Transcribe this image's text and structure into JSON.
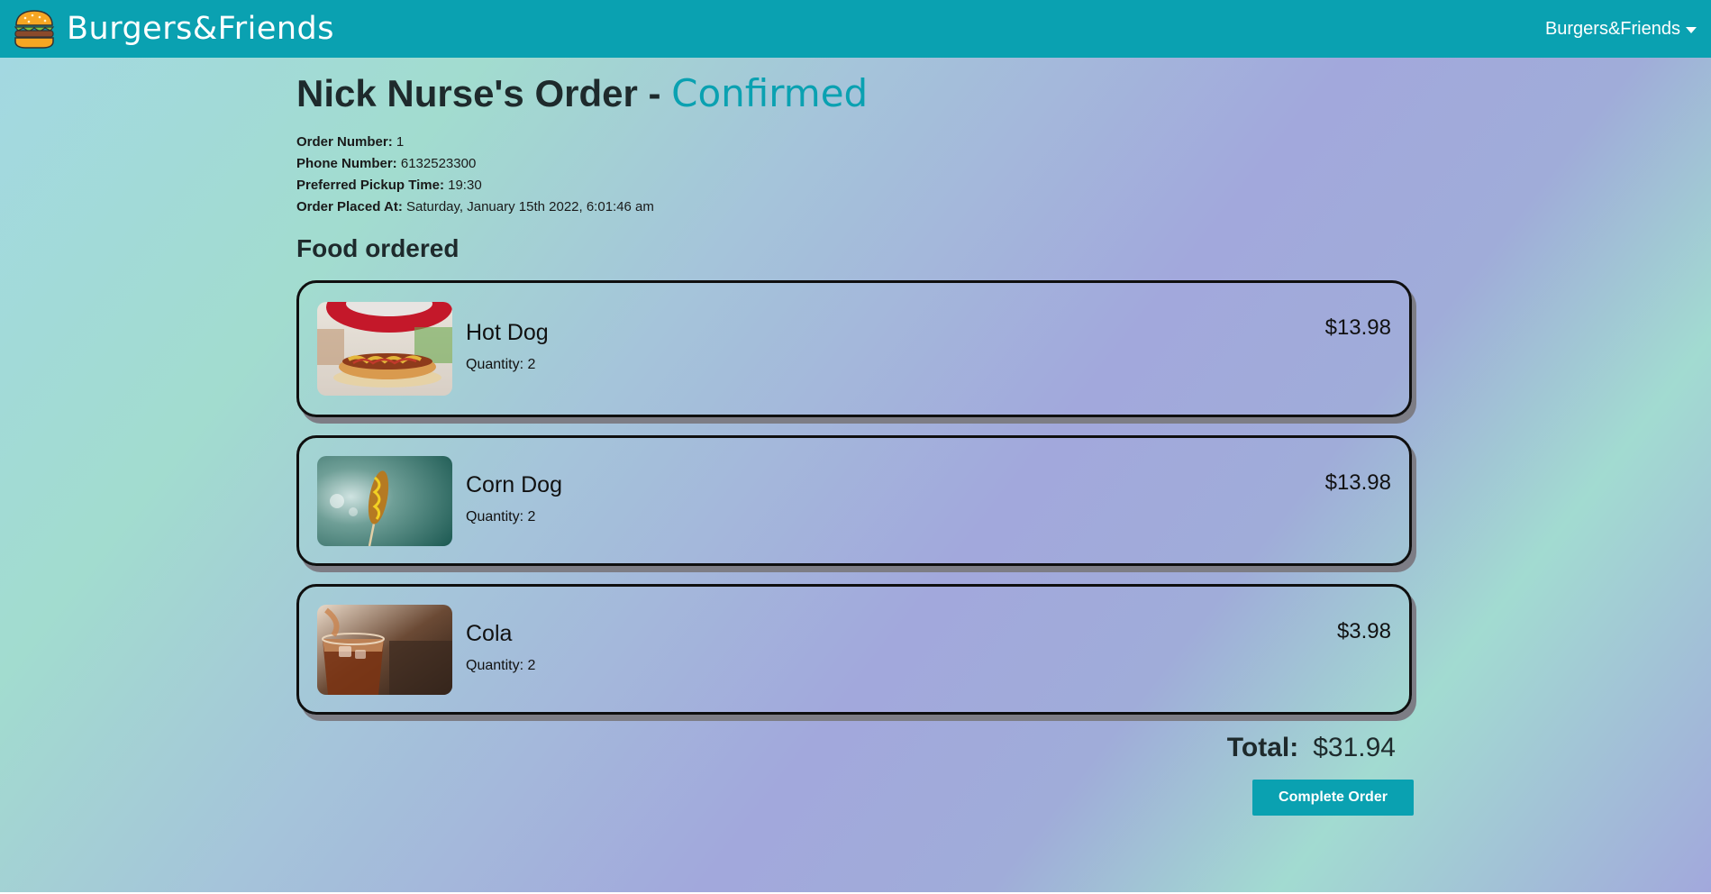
{
  "navbar": {
    "brand": "Burgers&Friends",
    "menu_label": "Burgers&Friends",
    "logo_icon": "burger-icon",
    "caret_icon": "caret-down-icon"
  },
  "order": {
    "title_prefix": "Nick Nurse's Order - ",
    "status": "Confirmed",
    "order_number_label": "Order Number:",
    "order_number": "1",
    "phone_label": "Phone Number:",
    "phone": "6132523300",
    "pickup_label": "Preferred Pickup Time:",
    "pickup_time": "19:30",
    "placed_label": "Order Placed At:",
    "placed_at": "Saturday, January 15th 2022, 6:01:46 am"
  },
  "food_section_title": "Food ordered",
  "items": [
    {
      "name": "Hot Dog",
      "quantity": "Quantity: 2",
      "price": "$13.98",
      "image": "hot-dog-photo"
    },
    {
      "name": "Corn Dog",
      "quantity": "Quantity: 2",
      "price": "$13.98",
      "image": "corn-dog-photo"
    },
    {
      "name": "Cola",
      "quantity": "Quantity: 2",
      "price": "$3.98",
      "image": "cola-photo"
    }
  ],
  "total": {
    "label": "Total:",
    "value": "$31.94"
  },
  "complete_button": "Complete Order",
  "colors": {
    "accent": "#0aa1b1",
    "card_border": "#0f0f0f",
    "card_shadow": "#7d7d85"
  }
}
